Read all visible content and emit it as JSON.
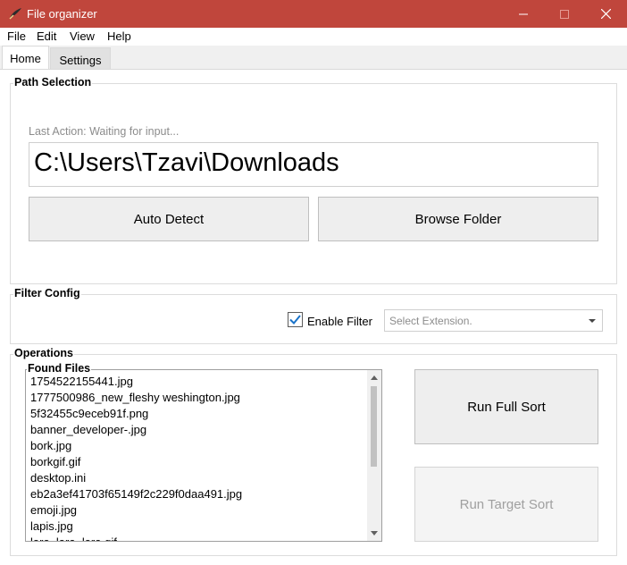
{
  "window": {
    "title": "File organizer"
  },
  "menu": {
    "items": [
      "File",
      "Edit",
      "View",
      "Help"
    ]
  },
  "tabs": [
    "Home",
    "Settings"
  ],
  "path_selection": {
    "title": "Path Selection",
    "status": "Last Action: Waiting for input...",
    "path": "C:\\Users\\Tzavi\\Downloads",
    "auto_detect": "Auto Detect",
    "browse": "Browse Folder"
  },
  "filter_config": {
    "title": "Filter Config",
    "enable_label": "Enable Filter",
    "enabled": true,
    "ext_placeholder": "Select Extension."
  },
  "operations": {
    "title": "Operations",
    "found_title": "Found Files",
    "files": [
      "1754522155441.jpg",
      "1777500986_new_fleshy weshington.jpg",
      "5f32455c9eceb91f.png",
      "banner_developer-.jpg",
      "bork.jpg",
      "borkgif.gif",
      "desktop.ini",
      "eb2a3ef41703f65149f2c229f0daa491.jpg",
      "emoji.jpg",
      "lapis.jpg",
      "lara_lara_lara.gif"
    ],
    "run_full": "Run Full Sort",
    "run_target": "Run Target Sort"
  },
  "colors": {
    "titlebar": "#c0463c",
    "checkbox_check": "#1a73c9"
  }
}
